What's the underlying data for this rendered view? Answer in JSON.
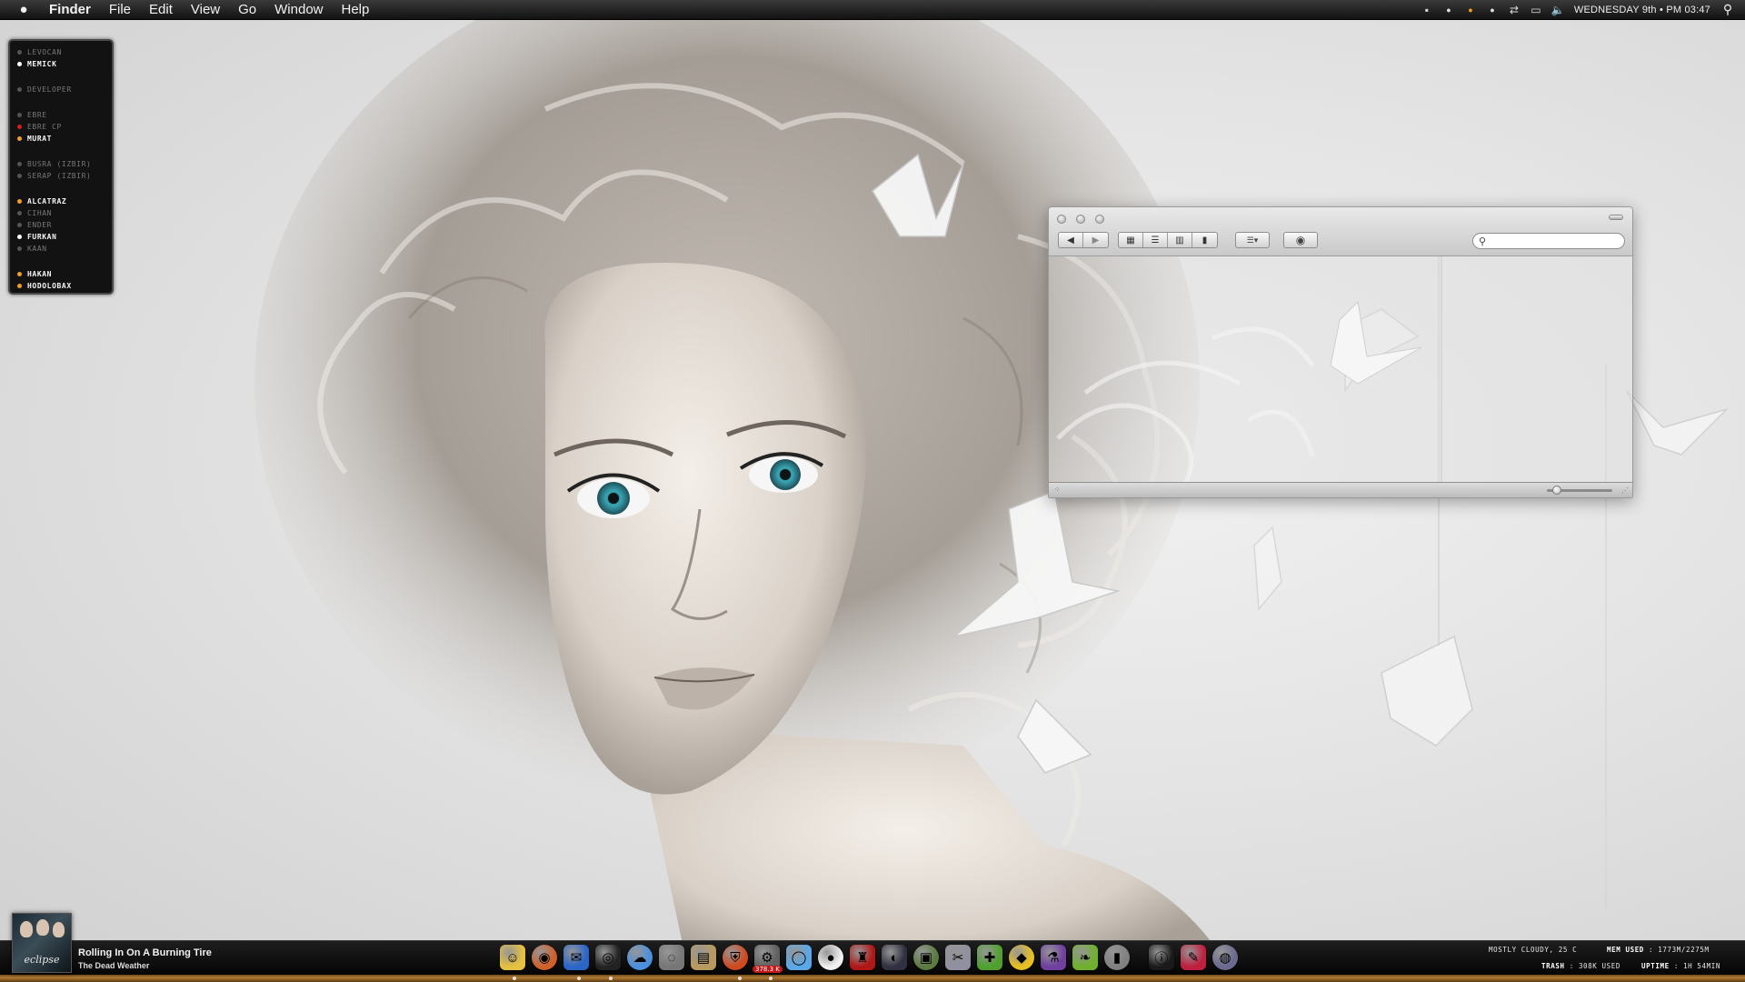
{
  "menubar": {
    "apple_icon": "apple-logo-icon",
    "menus": [
      "Finder",
      "File",
      "Edit",
      "View",
      "Go",
      "Window",
      "Help"
    ],
    "clock": "WEDNESDAY 9th  •  PM 03:47",
    "status_colors": {
      "away": "#f0a020",
      "online": "#ffffff"
    }
  },
  "contacts": {
    "groups": [
      [
        {
          "name": "LEVOCAN",
          "status": "offline"
        },
        {
          "name": "MEMICK",
          "status": "online"
        }
      ],
      [
        {
          "name": "DEVELOPER",
          "status": "offline"
        }
      ],
      [
        {
          "name": "EBRE",
          "status": "offline"
        },
        {
          "name": "EBRE CP",
          "status": "busy"
        },
        {
          "name": "MURAT",
          "status": "away"
        }
      ],
      [
        {
          "name": "BUSRA (IZBIR)",
          "status": "offline"
        },
        {
          "name": "SERAP (IZBIR)",
          "status": "offline"
        }
      ],
      [
        {
          "name": "ALCATRAZ",
          "status": "away"
        },
        {
          "name": "CIHAN",
          "status": "offline"
        },
        {
          "name": "ENDER",
          "status": "offline"
        },
        {
          "name": "FURKAN",
          "status": "online"
        },
        {
          "name": "KAAN",
          "status": "offline"
        }
      ],
      [
        {
          "name": "HAKAN",
          "status": "away"
        },
        {
          "name": "HODOLOBAX",
          "status": "away"
        }
      ]
    ],
    "status_colors": {
      "online": "#ffffff",
      "away": "#f0a020",
      "busy": "#d02020",
      "offline": "#555555"
    }
  },
  "finder": {
    "search": {
      "value": "",
      "placeholder": ""
    },
    "zoom_level": 0.1
  },
  "now_playing": {
    "title": "Rolling In On A Burning Tire",
    "artist": "The Dead Weather",
    "album_art_text": "eclipse"
  },
  "dock": {
    "icons": [
      {
        "name": "finder-face-icon",
        "bg": "#e6c040",
        "glyph": "☺"
      },
      {
        "name": "browser-icon",
        "bg": "#d0602a",
        "glyph": "◉"
      },
      {
        "name": "mail-bird-icon",
        "bg": "#2a66c8",
        "glyph": "✉"
      },
      {
        "name": "camera-icon",
        "bg": "#222222",
        "glyph": "◎"
      },
      {
        "name": "cloud-icon",
        "bg": "#4a90e0",
        "glyph": "☁"
      },
      {
        "name": "quicktime-icon",
        "bg": "#777777",
        "glyph": "◌"
      },
      {
        "name": "preview-icon",
        "bg": "#b89a60",
        "glyph": "▤"
      },
      {
        "name": "shield-icon",
        "bg": "#d04a20",
        "glyph": "⛨"
      },
      {
        "name": "system-preferences-icon",
        "bg": "#606060",
        "glyph": "⚙"
      },
      {
        "name": "chat-bubble-icon",
        "bg": "#5aa8e8",
        "glyph": "◯"
      },
      {
        "name": "penguin-icon",
        "bg": "#f0f0f0",
        "glyph": "●"
      },
      {
        "name": "red-chair-icon",
        "bg": "#b01818",
        "glyph": "♜"
      },
      {
        "name": "music-dark-icon",
        "bg": "#303040",
        "glyph": "◐"
      },
      {
        "name": "photo-frame-icon",
        "bg": "#5a7a40",
        "glyph": "▣"
      },
      {
        "name": "scissors-icon",
        "bg": "#9090a0",
        "glyph": "✂"
      },
      {
        "name": "puzzle-icon",
        "bg": "#50a030",
        "glyph": "✚"
      },
      {
        "name": "cube-icon",
        "bg": "#e8c020",
        "glyph": "◆"
      },
      {
        "name": "plug-icon",
        "bg": "#7040a0",
        "glyph": "⚗"
      },
      {
        "name": "leaf-icon",
        "bg": "#70b030",
        "glyph": "❧"
      },
      {
        "name": "utility-bar-icon",
        "bg": "#808080",
        "glyph": "▮"
      },
      {
        "name": "info-icon",
        "bg": "#1a1a1a",
        "glyph": "ⓘ"
      },
      {
        "name": "pencil-icon",
        "bg": "#c02040",
        "glyph": "✎"
      },
      {
        "name": "trash-orb-icon",
        "bg": "#6a6a90",
        "glyph": "◍"
      }
    ],
    "badge": "378.3 K"
  },
  "stats": {
    "weather": "MOSTLY CLOUDY, 25 C",
    "mem_label": "MEM USED",
    "mem_value": "1773M/2275M",
    "trash_label": "TRASH",
    "trash_value": "308K USED",
    "uptime_label": "UPTIME",
    "uptime_value": "1H 54MIN"
  }
}
